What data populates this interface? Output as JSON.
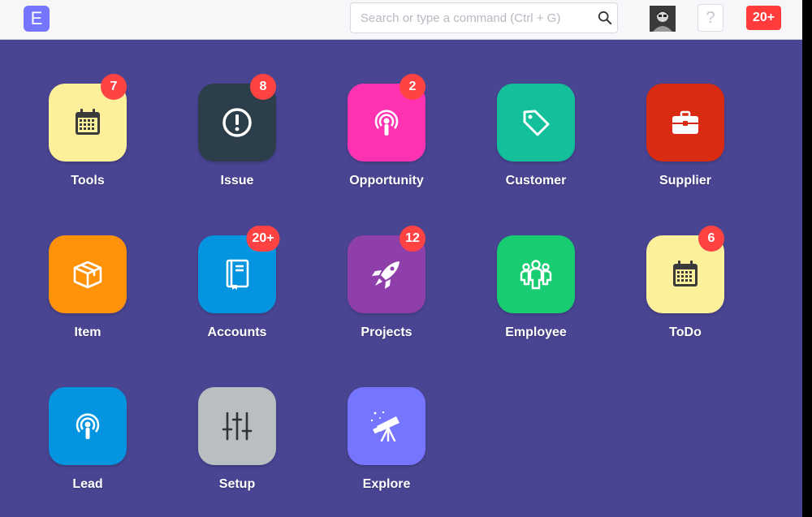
{
  "navbar": {
    "logo_letter": "E",
    "search": {
      "placeholder": "Search or type a command (Ctrl + G)"
    },
    "help_label": "?",
    "notifications_count": "20+"
  },
  "colors": {
    "navbar_bg": "#f7f7f9",
    "desktop_bg": "#4a4593",
    "badge": "#ff4242"
  },
  "apps": [
    {
      "label": "Tools",
      "badge": "7",
      "color": "#fdf09b",
      "icon": "calendar-icon"
    },
    {
      "label": "Issue",
      "badge": "8",
      "color": "#2c3e49",
      "icon": "alert-circle-icon"
    },
    {
      "label": "Opportunity",
      "badge": "2",
      "color": "#ff33b2",
      "icon": "broadcast-icon"
    },
    {
      "label": "Customer",
      "badge": "",
      "color": "#13c09b",
      "icon": "tag-icon"
    },
    {
      "label": "Supplier",
      "badge": "",
      "color": "#d82b12",
      "icon": "briefcase-icon"
    },
    {
      "label": "Item",
      "badge": "",
      "color": "#ff9208",
      "icon": "package-icon"
    },
    {
      "label": "Accounts",
      "badge": "20+",
      "color": "#0494e0",
      "icon": "book-icon"
    },
    {
      "label": "Projects",
      "badge": "12",
      "color": "#8f3fa9",
      "icon": "rocket-icon"
    },
    {
      "label": "Employee",
      "badge": "",
      "color": "#18cc72",
      "icon": "people-icon"
    },
    {
      "label": "ToDo",
      "badge": "6",
      "color": "#fdf09b",
      "icon": "calendar-icon"
    },
    {
      "label": "Lead",
      "badge": "",
      "color": "#0494e0",
      "icon": "broadcast-icon"
    },
    {
      "label": "Setup",
      "badge": "",
      "color": "#b9bec1",
      "icon": "sliders-icon"
    },
    {
      "label": "Explore",
      "badge": "",
      "color": "#7575ff",
      "icon": "telescope-icon"
    }
  ]
}
